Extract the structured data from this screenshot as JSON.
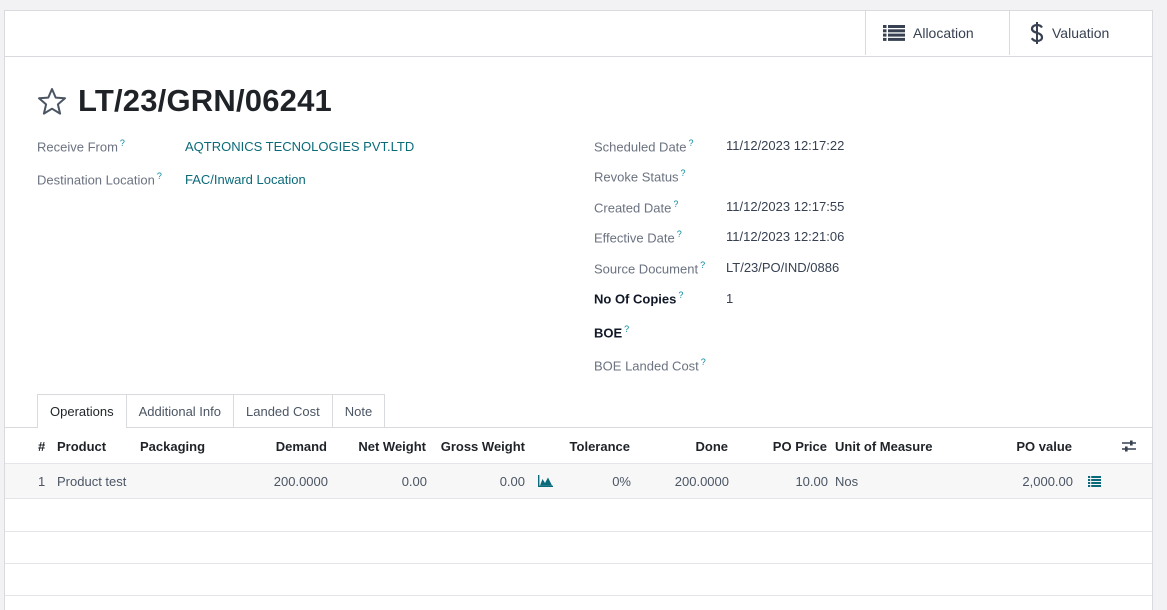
{
  "buttons": {
    "allocation": "Allocation",
    "valuation": "Valuation"
  },
  "record": {
    "title": "LT/23/GRN/06241"
  },
  "left_fields": [
    {
      "label": "Receive From",
      "value": "AQTRONICS TECNOLOGIES PVT.LTD"
    },
    {
      "label": "Destination Location",
      "value": "FAC/Inward Location"
    }
  ],
  "right_fields": [
    {
      "label": "Scheduled Date",
      "value": "11/12/2023 12:17:22"
    },
    {
      "label": "Revoke Status",
      "value": ""
    },
    {
      "label": "Created Date",
      "value": "11/12/2023 12:17:55"
    },
    {
      "label": "Effective Date",
      "value": "11/12/2023 12:21:06"
    },
    {
      "label": "Source Document",
      "value": "LT/23/PO/IND/0886"
    },
    {
      "label": "No Of Copies",
      "value": "1"
    },
    {
      "label": "BOE",
      "value": ""
    },
    {
      "label": "BOE Landed Cost",
      "value": ""
    }
  ],
  "help_mark": "?",
  "tabs": [
    "Operations",
    "Additional Info",
    "Landed Cost",
    "Note"
  ],
  "table": {
    "columns": [
      "#",
      "Product",
      "Packaging",
      "Demand",
      "Net Weight",
      "Gross Weight",
      "Tolerance",
      "Done",
      "PO Price",
      "Unit of Measure",
      "PO value"
    ],
    "rows": [
      {
        "num": "1",
        "product": "Product test",
        "packaging": "",
        "demand": "200.0000",
        "net_weight": "0.00",
        "gross_weight": "0.00",
        "tolerance": "0%",
        "done": "200.0000",
        "po_price": "10.00",
        "uom": "Nos",
        "po_value": "2,000.00"
      }
    ]
  },
  "colors": {
    "link": "#0b6a7a",
    "help": "#0a8a9e",
    "border": "#d8dadd",
    "row_bg": "#f7f7f8"
  }
}
